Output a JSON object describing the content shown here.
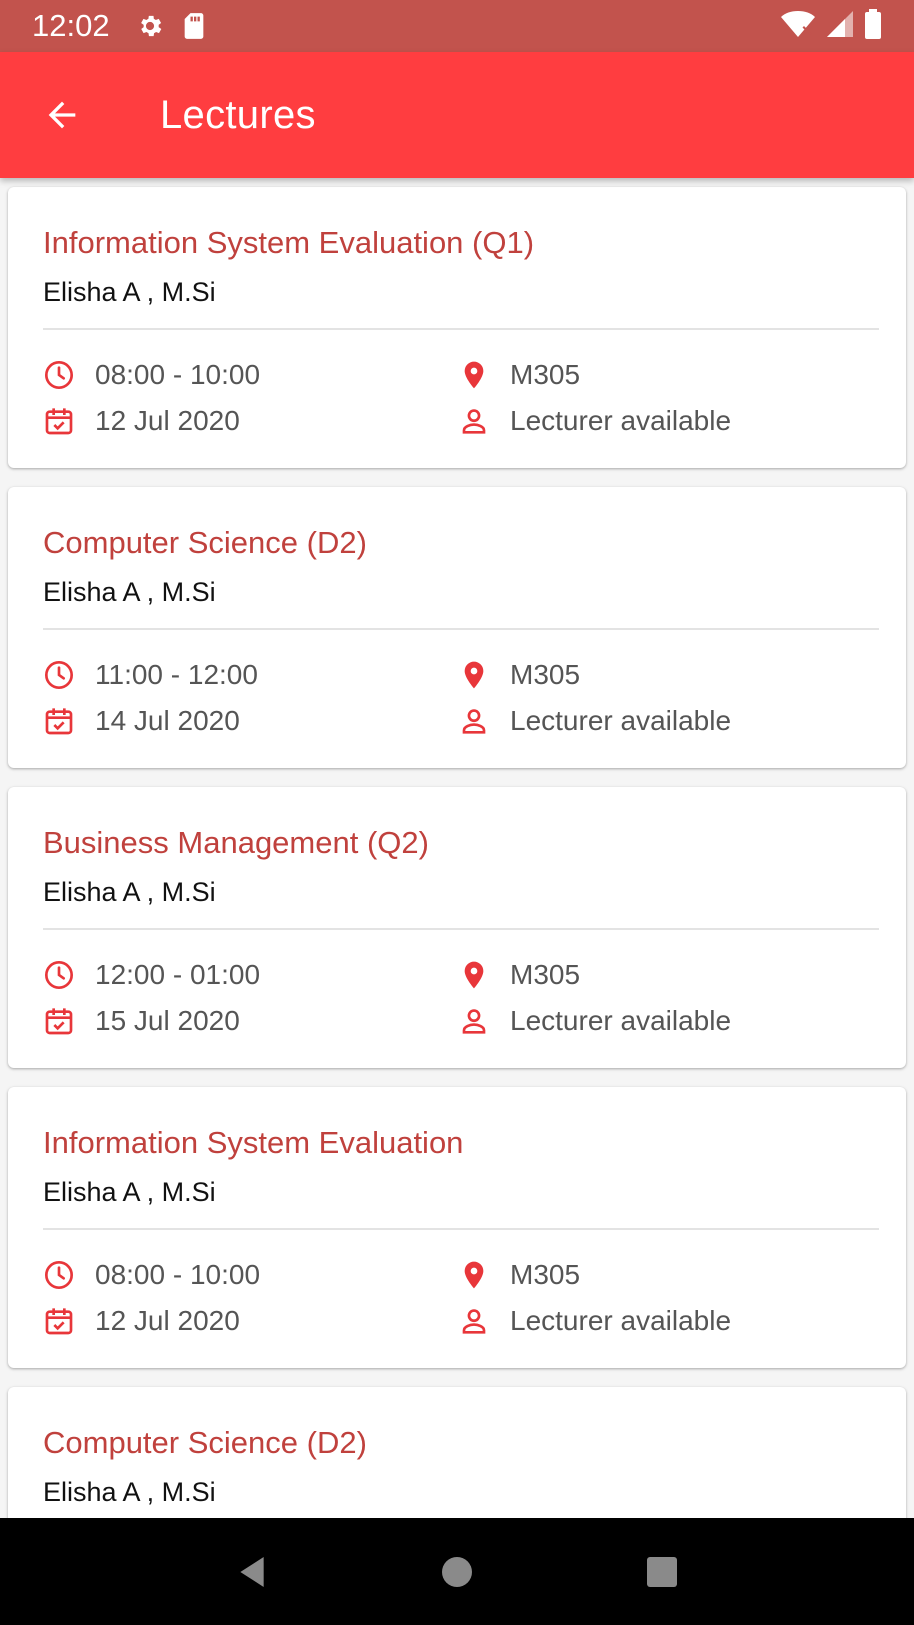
{
  "status_bar": {
    "time": "12:02"
  },
  "app_bar": {
    "title": "Lectures"
  },
  "colors": {
    "accent": "#ff3d40",
    "status_bar": "#c2534d",
    "course_title": "#c0413d"
  },
  "lectures": [
    {
      "course": "Information System Evaluation (Q1)",
      "lecturer": "Elisha A , M.Si",
      "time": "08:00 - 10:00",
      "date": "12 Jul 2020",
      "room": "M305",
      "availability": "Lecturer available"
    },
    {
      "course": "Computer Science (D2)",
      "lecturer": "Elisha A , M.Si",
      "time": "11:00 - 12:00",
      "date": "14 Jul 2020",
      "room": "M305",
      "availability": "Lecturer available"
    },
    {
      "course": "Business Management (Q2)",
      "lecturer": "Elisha A , M.Si",
      "time": "12:00 - 01:00",
      "date": "15 Jul 2020",
      "room": "M305",
      "availability": "Lecturer available"
    },
    {
      "course": "Information System Evaluation",
      "lecturer": "Elisha A , M.Si",
      "time": "08:00 - 10:00",
      "date": "12 Jul 2020",
      "room": "M305",
      "availability": "Lecturer available"
    },
    {
      "course": "Computer Science (D2)",
      "lecturer": "Elisha A , M.Si",
      "time": "",
      "date": "",
      "room": "",
      "availability": ""
    }
  ],
  "icons": {
    "status": [
      "gear-icon",
      "sd-card-icon",
      "wifi-off-icon",
      "signal-icon",
      "battery-icon"
    ],
    "app_bar": "arrow-back-icon",
    "card": [
      "clock-icon",
      "calendar-check-icon",
      "location-pin-icon",
      "person-icon"
    ],
    "nav": [
      "nav-back-icon",
      "nav-home-icon",
      "nav-recents-icon"
    ]
  }
}
